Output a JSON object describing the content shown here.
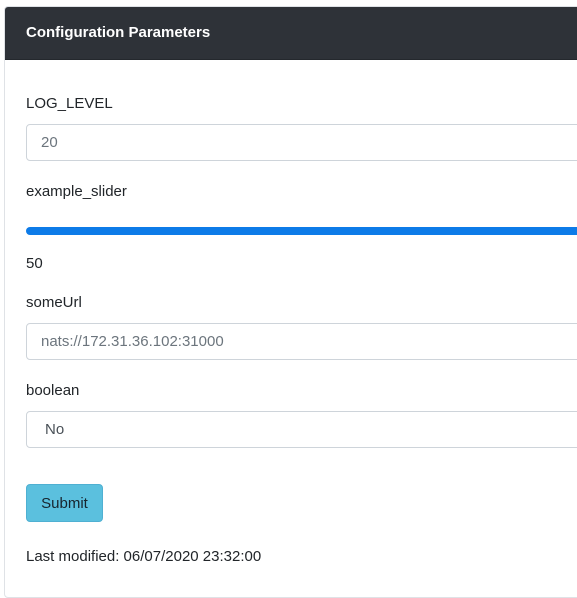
{
  "card": {
    "title": "Configuration Parameters"
  },
  "fields": {
    "log_level": {
      "label": "LOG_LEVEL",
      "value": "20"
    },
    "example_slider": {
      "label": "example_slider",
      "value": "50",
      "fill_percent": 100
    },
    "some_url": {
      "label": "someUrl",
      "value": "nats://172.31.36.102:31000"
    },
    "boolean": {
      "label": "boolean",
      "selected": "No"
    }
  },
  "actions": {
    "submit_label": "Submit"
  },
  "footer": {
    "last_modified": "Last modified: 06/07/2020 23:32:00"
  },
  "colors": {
    "header_bg": "#2e3238",
    "slider_fill": "#0d7be8",
    "button_bg": "#5bc0de"
  }
}
